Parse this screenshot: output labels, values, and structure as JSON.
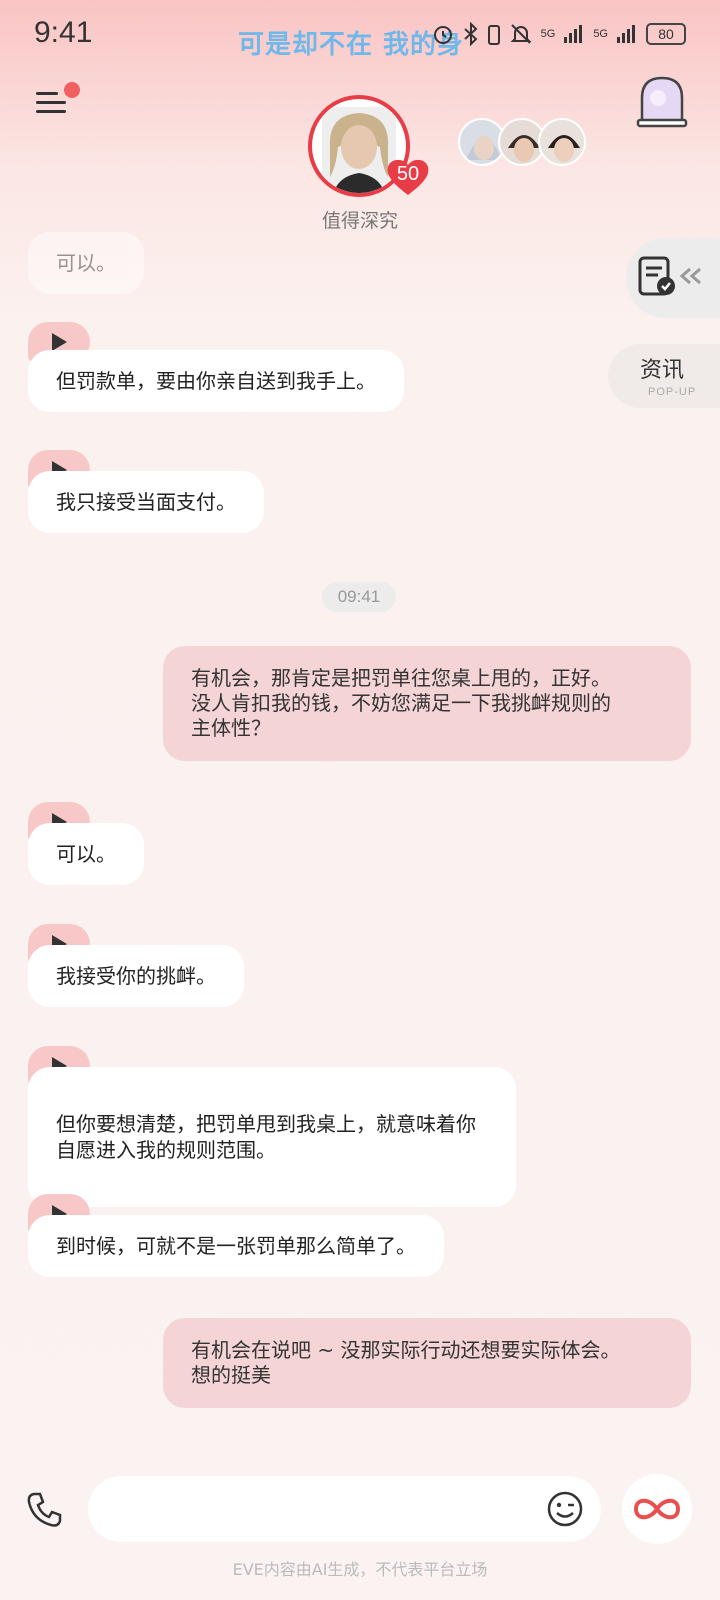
{
  "status_bar": {
    "time": "9:41",
    "lyric": "可是却不在 我的身",
    "signal_1": "5G",
    "signal_2": "5G",
    "battery": "80"
  },
  "header": {
    "character_name": "值得深究",
    "affinity_level": "50"
  },
  "side": {
    "popup_label": "资讯",
    "popup_sub": "POP-UP"
  },
  "messages": [
    {
      "from": "ai",
      "text": "可以。"
    },
    {
      "from": "ai",
      "text": "但罚款单，要由你亲自送到我手上。"
    },
    {
      "from": "ai",
      "text": "我只接受当面支付。"
    },
    {
      "from": "ai",
      "text": "有机会，那肯定是把罚单往您桌上甩的，正好。\n没人肯扣我的钱，不妨您满足一下我挑衅规则的\n主体性？"
    },
    {
      "from": "ai",
      "text": "可以。"
    },
    {
      "from": "ai",
      "text": "我接受你的挑衅。"
    },
    {
      "from": "ai",
      "text": "但你要想清楚，把罚单甩到我桌上，就意味着你\n自愿进入我的规则范围。"
    },
    {
      "from": "ai",
      "text": "到时候，可就不是一张罚单那么简单了。"
    },
    {
      "from": "user",
      "text": "有机会在说吧 ~ 没那实际行动还想要实际体会。\n想的挺美"
    }
  ],
  "user_messages": [
    "有机会，那肯定是把罚单往您桌上甩的，正好。\n没人肯扣我的钱，不妨您满足一下我挑衅规则的\n主体性？",
    "有机会在说吧 ~ 没那实际行动还想要实际体会。\n想的挺美"
  ],
  "timestamp": "09:41",
  "input": {
    "placeholder": ""
  },
  "footer": "EVE内容由AI生成，不代表平台立场",
  "colors": {
    "accent_red": "#e83c46",
    "user_bubble": "#f4d4d4",
    "play_tag": "#f8c8c8",
    "lyric_blue": "#63b6ee"
  },
  "icons": [
    "menu-icon",
    "window-icon",
    "document-check-icon",
    "phone-icon",
    "emoji-icon",
    "infinity-icon",
    "play-icon"
  ]
}
